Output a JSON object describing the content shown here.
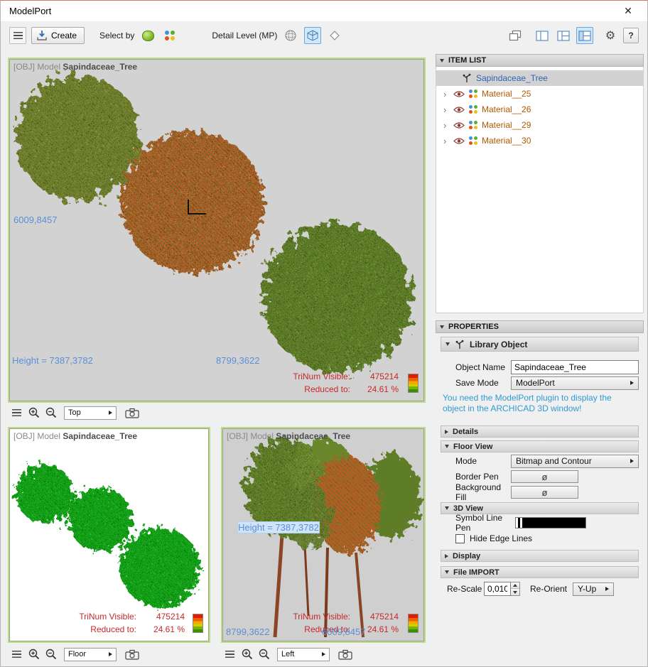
{
  "window": {
    "title": "ModelPort"
  },
  "icons": {
    "close": "✕",
    "gear": "⚙",
    "chevron": "›",
    "empty_pen": "ø"
  },
  "toolbar": {
    "create_label": "Create",
    "select_by_label": "Select by",
    "detail_level_label": "Detail Level (MP)",
    "help_label": "?"
  },
  "viewport_common": {
    "header_prefix": "[OBJ] Model",
    "model_name": "Sapindaceae_Tree",
    "trinum_label": "TriNum Visible:",
    "trinum_value": "475214",
    "reduced_label": "Reduced to:",
    "reduced_value": "24.61 %"
  },
  "viewports": {
    "top": {
      "view_name": "Top",
      "coord_left": "6009,8457",
      "height_label": "Height = 7387,3782",
      "coord_bottom": "8799,3622"
    },
    "floor": {
      "view_name": "Floor"
    },
    "left": {
      "view_name": "Left",
      "height_label": "Height = 7387,3782",
      "coord_bottom": "8799,3622",
      "coord_overlay": "6009,8457"
    }
  },
  "item_list": {
    "header": "ITEM LIST",
    "root_item": "Sapindaceae_Tree",
    "materials": [
      "Material__25",
      "Material__26",
      "Material__29",
      "Material__30"
    ]
  },
  "properties": {
    "header": "PROPERTIES",
    "library_object_label": "Library Object",
    "object_name_label": "Object Name",
    "object_name_value": "Sapindaceae_Tree",
    "save_mode_label": "Save Mode",
    "save_mode_value": "ModelPort",
    "plugin_note": "You need the ModelPort plugin to display the object in the ARCHICAD 3D window!",
    "details_section": "Details",
    "floor_view_section": "Floor View",
    "mode_label": "Mode",
    "mode_value": "Bitmap and Contour",
    "border_pen_label": "Border Pen",
    "background_fill_label": "Background Fill",
    "view3d_section": "3D View",
    "symbol_line_pen_label": "Symbol Line Pen",
    "hide_edge_lines_label": "Hide Edge Lines",
    "display_section": "Display",
    "file_import_section": "File IMPORT",
    "rescale_label": "Re-Scale",
    "rescale_value": "0,010",
    "reorient_label": "Re-Orient",
    "reorient_value": "Y-Up"
  },
  "colors": {
    "accent_note_blue": "#2f9bd4",
    "selection_blue": "#2b64b4",
    "material_text": "#b05a00",
    "stat_red": "#c52a2a",
    "measure_blue": "#5b8fd6",
    "viewport_border_green": "#bdda8d"
  }
}
